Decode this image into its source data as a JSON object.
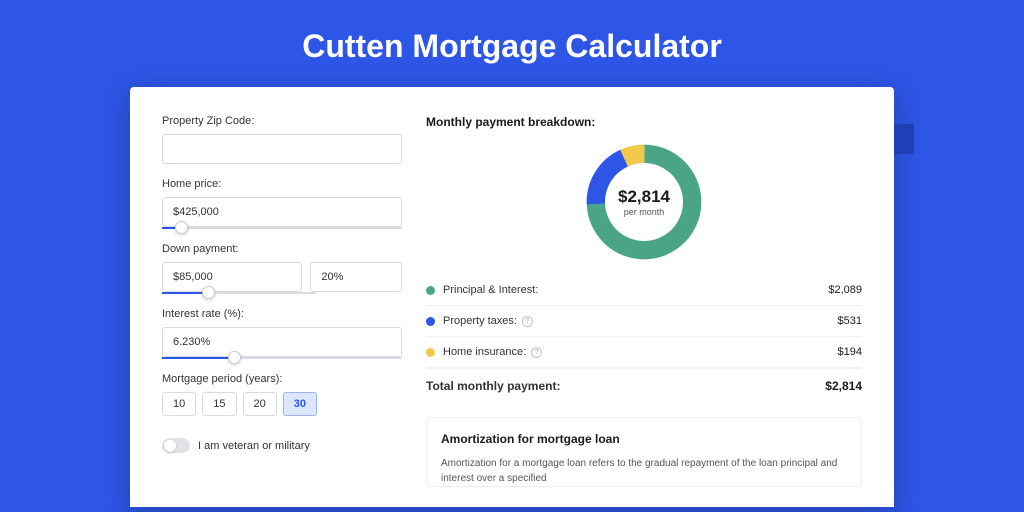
{
  "title": "Cutten Mortgage Calculator",
  "form": {
    "zip_label": "Property Zip Code:",
    "zip_value": "",
    "home_price_label": "Home price:",
    "home_price_value": "$425,000",
    "home_price_slider_pct": 8,
    "down_label": "Down payment:",
    "down_value": "$85,000",
    "down_pct": "20%",
    "down_slider_pct": 20,
    "rate_label": "Interest rate (%):",
    "rate_value": "6.230%",
    "rate_slider_pct": 30,
    "period_label": "Mortgage period (years):",
    "periods": [
      "10",
      "15",
      "20",
      "30"
    ],
    "period_selected": "30",
    "veteran_label": "I am veteran or military"
  },
  "breakdown": {
    "title": "Monthly payment breakdown:",
    "donut_amount": "$2,814",
    "donut_sub": "per month",
    "items": [
      {
        "label": "Principal & Interest:",
        "value": "$2,089",
        "color": "#4aa587",
        "info": false
      },
      {
        "label": "Property taxes:",
        "value": "$531",
        "color": "#2e56e6",
        "info": true
      },
      {
        "label": "Home insurance:",
        "value": "$194",
        "color": "#f2c84b",
        "info": true
      }
    ],
    "total_label": "Total monthly payment:",
    "total_value": "$2,814"
  },
  "amort": {
    "title": "Amortization for mortgage loan",
    "text": "Amortization for a mortgage loan refers to the gradual repayment of the loan principal and interest over a specified"
  },
  "chart_data": {
    "type": "pie",
    "title": "Monthly payment breakdown",
    "categories": [
      "Principal & Interest",
      "Property taxes",
      "Home insurance"
    ],
    "values": [
      2089,
      531,
      194
    ],
    "colors": [
      "#4aa587",
      "#2e56e6",
      "#f2c84b"
    ],
    "total": 2814
  }
}
